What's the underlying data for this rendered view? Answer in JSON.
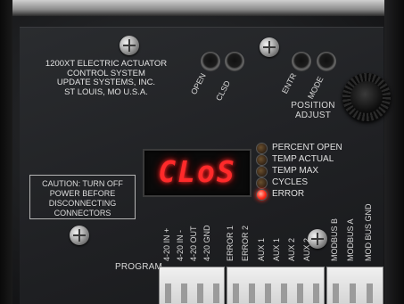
{
  "panel": {
    "title_line1": "1200XT ELECTRIC ACTUATOR",
    "title_line2": "CONTROL SYSTEM",
    "title_line3": "UPDATE SYSTEMS, INC.",
    "title_line4": "ST LOUIS, MO  U.S.A."
  },
  "buttons": {
    "open_label": "OPEN",
    "clsd_label": "CLSD",
    "entr_label": "ENTR",
    "mode_label": "MODE"
  },
  "knob": {
    "label_line1": "POSITION",
    "label_line2": "ADJUST"
  },
  "display": {
    "value": "CLoS",
    "color": "#ff2a2a"
  },
  "indicators": [
    {
      "label": "PERCENT OPEN",
      "on": false
    },
    {
      "label": "TEMP ACTUAL",
      "on": false
    },
    {
      "label": "TEMP MAX",
      "on": false
    },
    {
      "label": "CYCLES",
      "on": false
    },
    {
      "label": "ERROR",
      "on": true
    }
  ],
  "caution": {
    "line1": "CAUTION: TURN OFF",
    "line2": "POWER BEFORE",
    "line3": "DISCONNECTING",
    "line4": "CONNECTORS"
  },
  "terminals": {
    "program_label": "PROGRAM",
    "labels": [
      "4-20 IN +",
      "4-20 IN -",
      "4-20 OUT",
      "4-20 GND",
      "ERROR 1",
      "ERROR 2",
      "AUX 1",
      "AUX 1",
      "AUX 2",
      "AUX 2",
      "MODBUS B",
      "MODBUS A",
      "MOD BUS GND"
    ]
  }
}
